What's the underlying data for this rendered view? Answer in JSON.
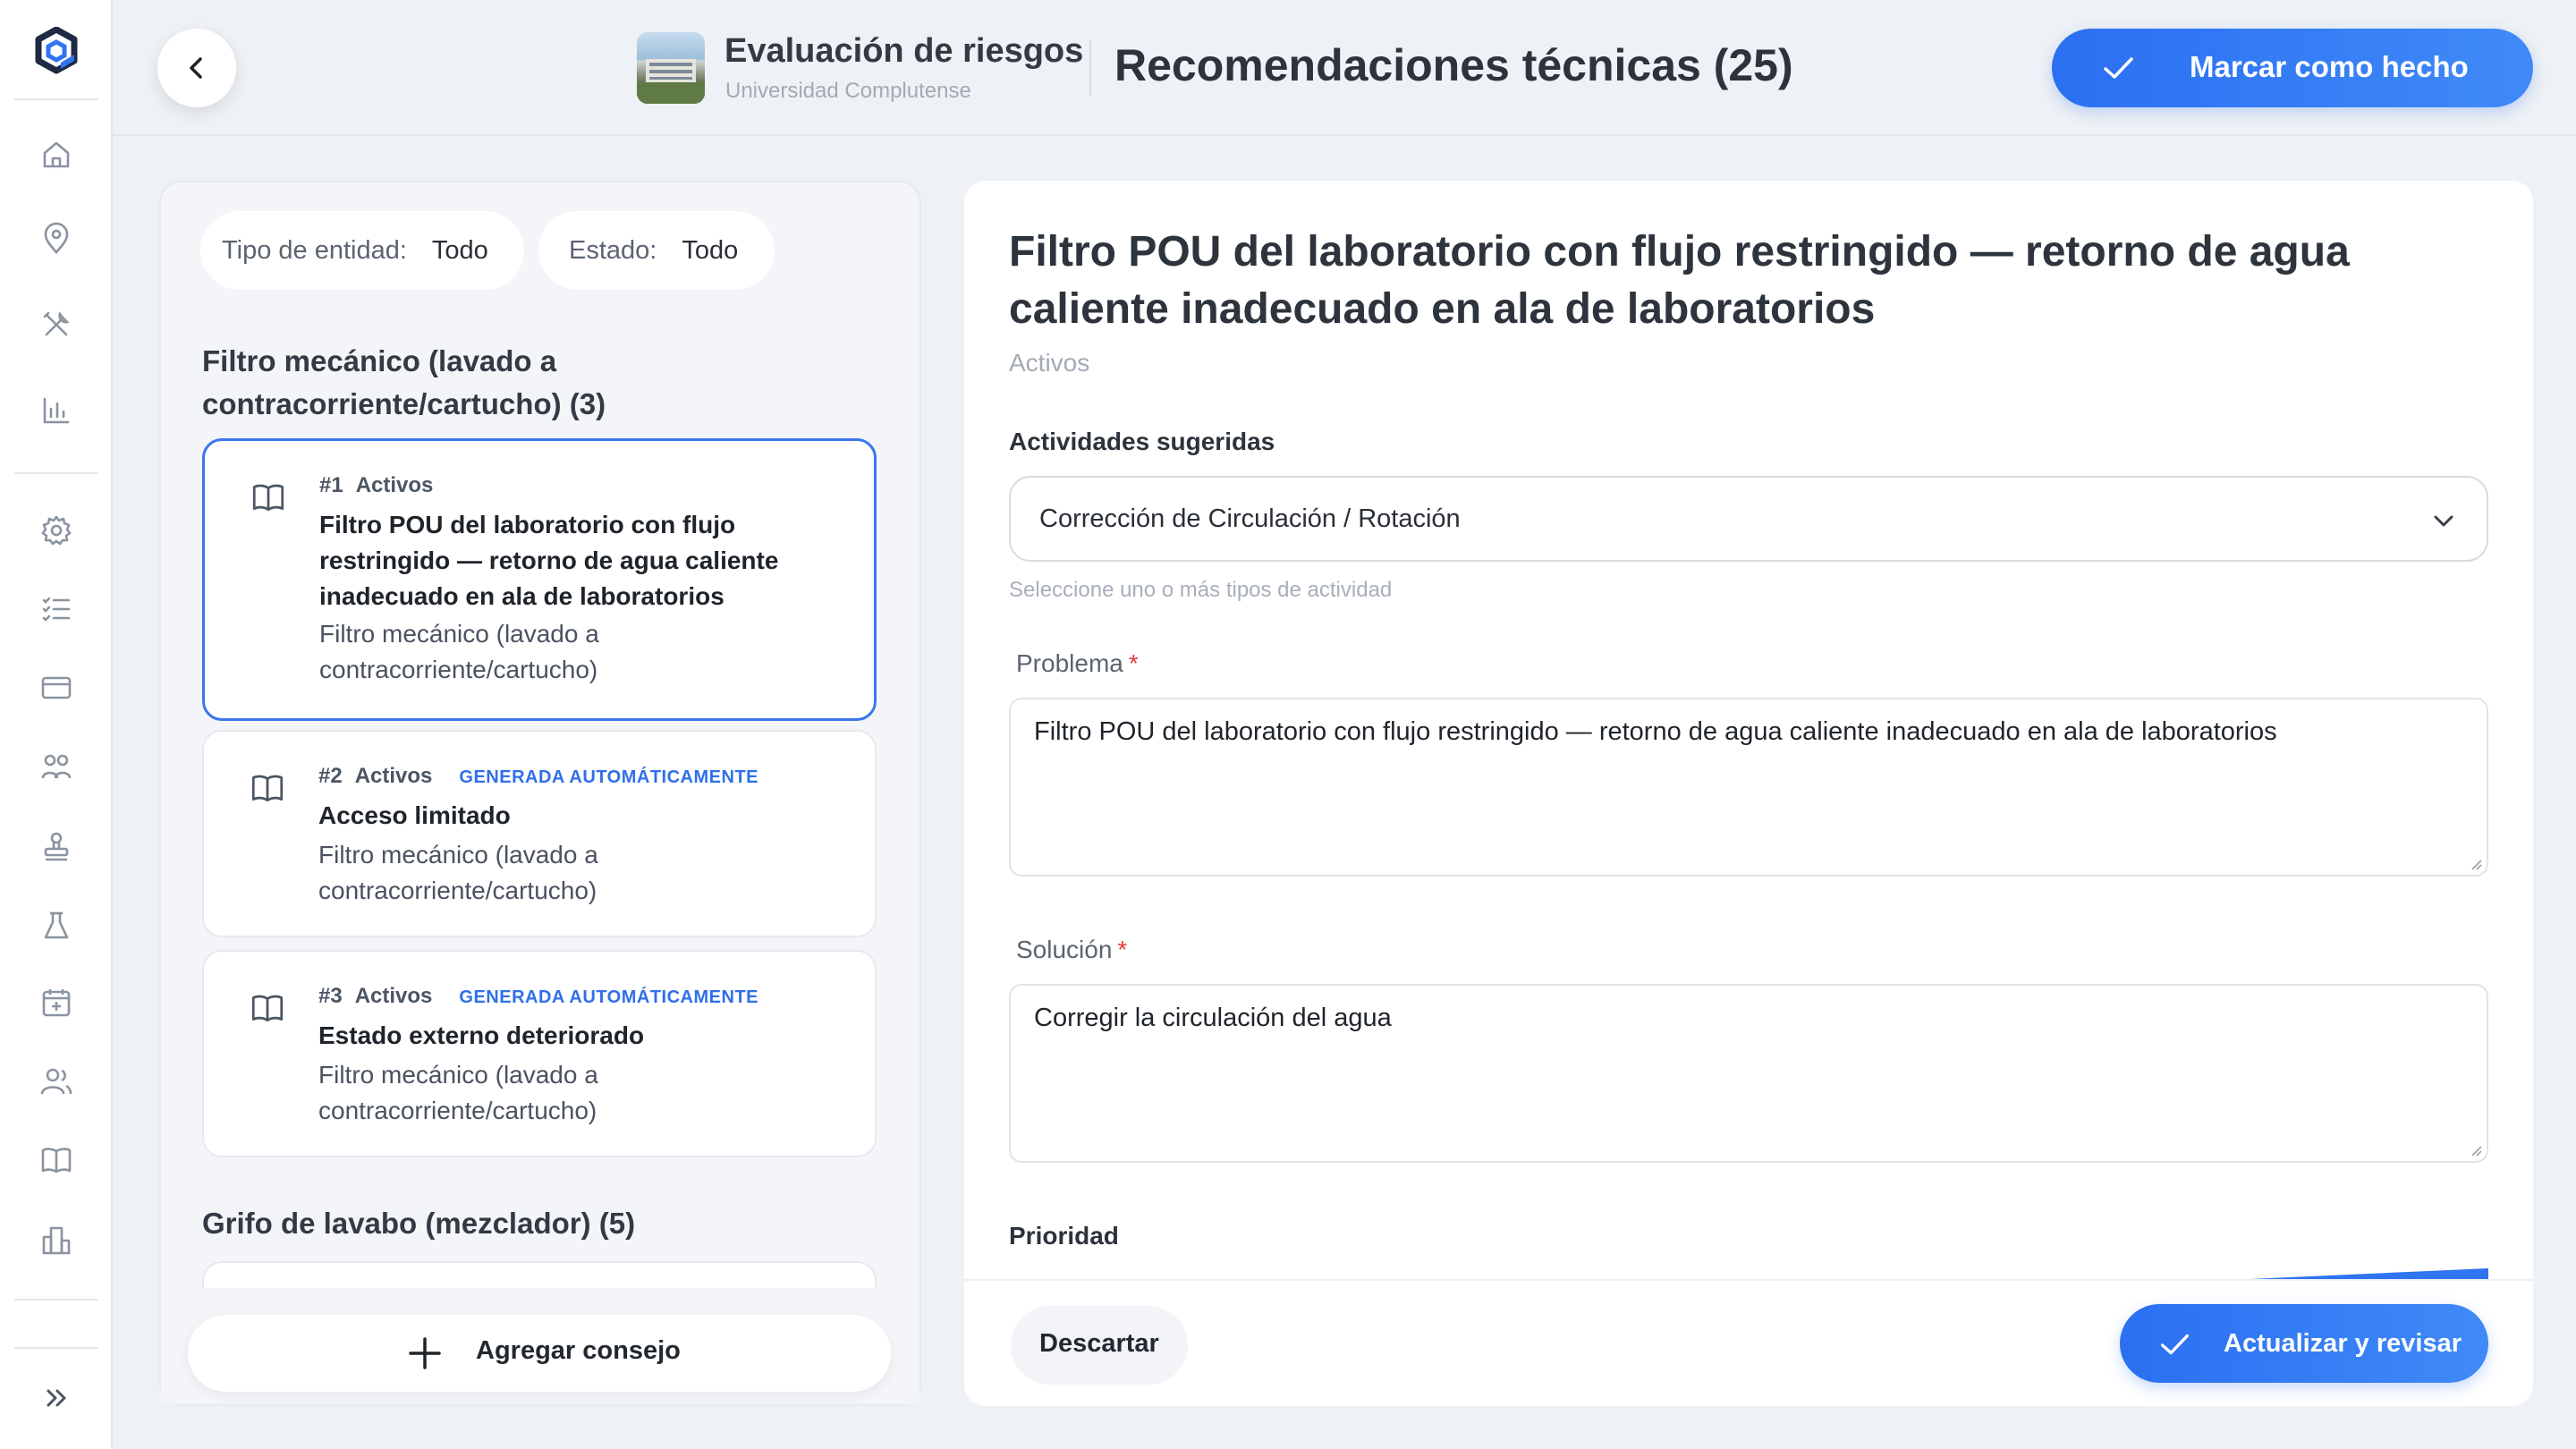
{
  "sidebar": {
    "logo": "brand-logo",
    "icons": [
      "home-icon",
      "location-pin-icon",
      "tools-icon",
      "chart-icon",
      "settings-icon",
      "checklist-icon",
      "card-icon",
      "people-network-icon",
      "stamp-icon",
      "flask-icon",
      "calendar-icon",
      "users-icon",
      "book-icon",
      "buildings-icon"
    ],
    "expand_icon": "double-chevron-right-icon"
  },
  "header": {
    "project_title": "Evaluación de riesgos",
    "project_subtitle": "Universidad Complutense",
    "page_title": "Recomendaciones técnicas (25)",
    "mark_done_label": "Marcar como hecho"
  },
  "filters": {
    "entity_type_label": "Tipo de entidad:",
    "entity_type_value": "Todo",
    "status_label": "Estado:",
    "status_value": "Todo"
  },
  "groups": [
    {
      "title": "Filtro mecánico (lavado a contracorriente/cartucho) (3)",
      "items": [
        {
          "number": "#1",
          "status": "Activos",
          "auto": "",
          "title": "Filtro POU del laboratorio con flujo restringido — retorno de agua caliente inadecuado en ala de laboratorios",
          "category": "Filtro mecánico (lavado a contracorriente/cartucho)"
        },
        {
          "number": "#2",
          "status": "Activos",
          "auto": "GENERADA AUTOMÁTICAMENTE",
          "title": "Acceso limitado",
          "category": "Filtro mecánico (lavado a contracorriente/cartucho)"
        },
        {
          "number": "#3",
          "status": "Activos",
          "auto": "GENERADA AUTOMÁTICAMENTE",
          "title": "Estado externo deteriorado",
          "category": "Filtro mecánico (lavado a contracorriente/cartucho)"
        }
      ]
    },
    {
      "title": "Grifo de lavabo (mezclador) (5)",
      "items": []
    }
  ],
  "add_tip_label": "Agregar consejo",
  "detail": {
    "title": "Filtro POU del laboratorio con flujo restringido — retorno de agua caliente inadecuado en ala de laboratorios",
    "category": "Activos",
    "activities_label": "Actividades sugeridas",
    "activities_value": "Corrección de Circulación / Rotación",
    "activities_hint": "Seleccione uno o más tipos de actividad",
    "problem_label": "Problema",
    "problem_value": "Filtro POU del laboratorio con flujo restringido — retorno de agua caliente inadecuado en ala de laboratorios",
    "solution_label": "Solución",
    "solution_value": "Corregir la circulación del agua",
    "priority_label": "Prioridad",
    "required_mark": "*",
    "discard_label": "Descartar",
    "update_label": "Actualizar y revisar"
  },
  "colors": {
    "accent": "#2f74f0",
    "active_border": "#3b76ee",
    "required": "#e23b3b",
    "auto_tag": "#2f6fe9"
  }
}
